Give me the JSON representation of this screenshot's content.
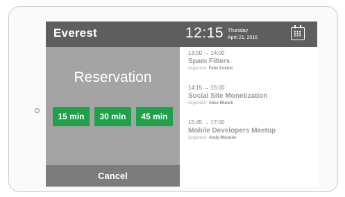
{
  "header": {
    "room": "Everest",
    "time": "12:15",
    "weekday": "Thursday",
    "date": "April 21, 2016",
    "calendar_icon": "calendar-icon"
  },
  "reserve": {
    "title": "Reservation",
    "durations": [
      "15 min",
      "30 min",
      "45 min"
    ],
    "cancel": "Cancel"
  },
  "events": [
    {
      "time": "13:00 → 14:00",
      "title": "Spam Filters",
      "organizer_label": "Organizer:",
      "organizer": "Felix Eskins"
    },
    {
      "time": "14:15 → 15:00",
      "title": "Social Site Monetization",
      "organizer_label": "Organizer:",
      "organizer": "Alice Munch"
    },
    {
      "time": "15:45 → 17:00",
      "title": "Mobile Developers Meetup",
      "organizer_label": "Organizer:",
      "organizer": "Andy Mounier"
    }
  ],
  "colors": {
    "header": "#5e5e5e",
    "panel": "#a4a4a4",
    "cancel": "#7c7c7c",
    "accent": "#1fa14a"
  }
}
